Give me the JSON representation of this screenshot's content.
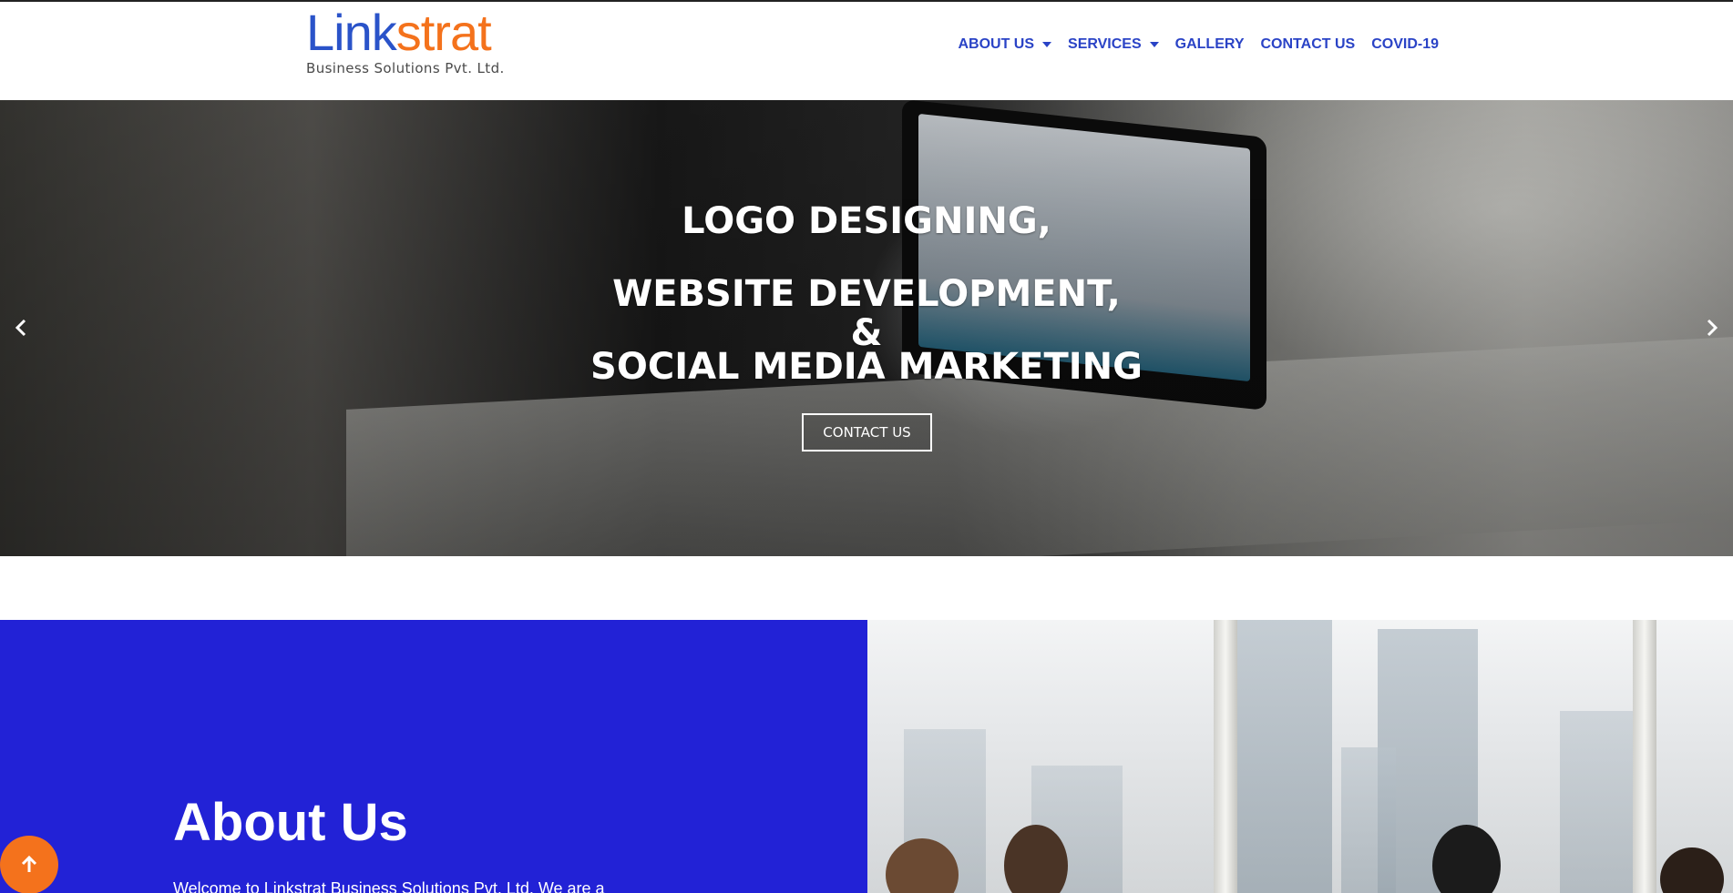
{
  "brand": {
    "name_part1": "Link",
    "name_part2": "strat",
    "tagline": "Business Solutions Pvt. Ltd.",
    "colors": {
      "blue": "#2a53c9",
      "orange": "#f4721c"
    }
  },
  "nav": {
    "items": [
      {
        "label": "ABOUT US",
        "has_dropdown": true
      },
      {
        "label": "SERVICES",
        "has_dropdown": true
      },
      {
        "label": "GALLERY",
        "has_dropdown": false
      },
      {
        "label": "CONTACT US",
        "has_dropdown": false
      },
      {
        "label": "COVID-19",
        "has_dropdown": false
      }
    ],
    "color": "#2a43c6"
  },
  "hero": {
    "line1": "LOGO DESIGNING,",
    "line2": "WEBSITE DEVELOPMENT,",
    "line3": "&",
    "line4": "SOCIAL MEDIA MARKETING",
    "button_label": "CONTACT US",
    "prev_icon": "chevron-left-icon",
    "next_icon": "chevron-right-icon"
  },
  "about": {
    "title": "About Us",
    "intro": "Welcome to Linkstrat Business Solutions Pvt. Ltd. We are a",
    "background_color": "#2222d6"
  },
  "back_to_top": {
    "icon": "arrow-up-icon",
    "color": "#f4721c"
  }
}
